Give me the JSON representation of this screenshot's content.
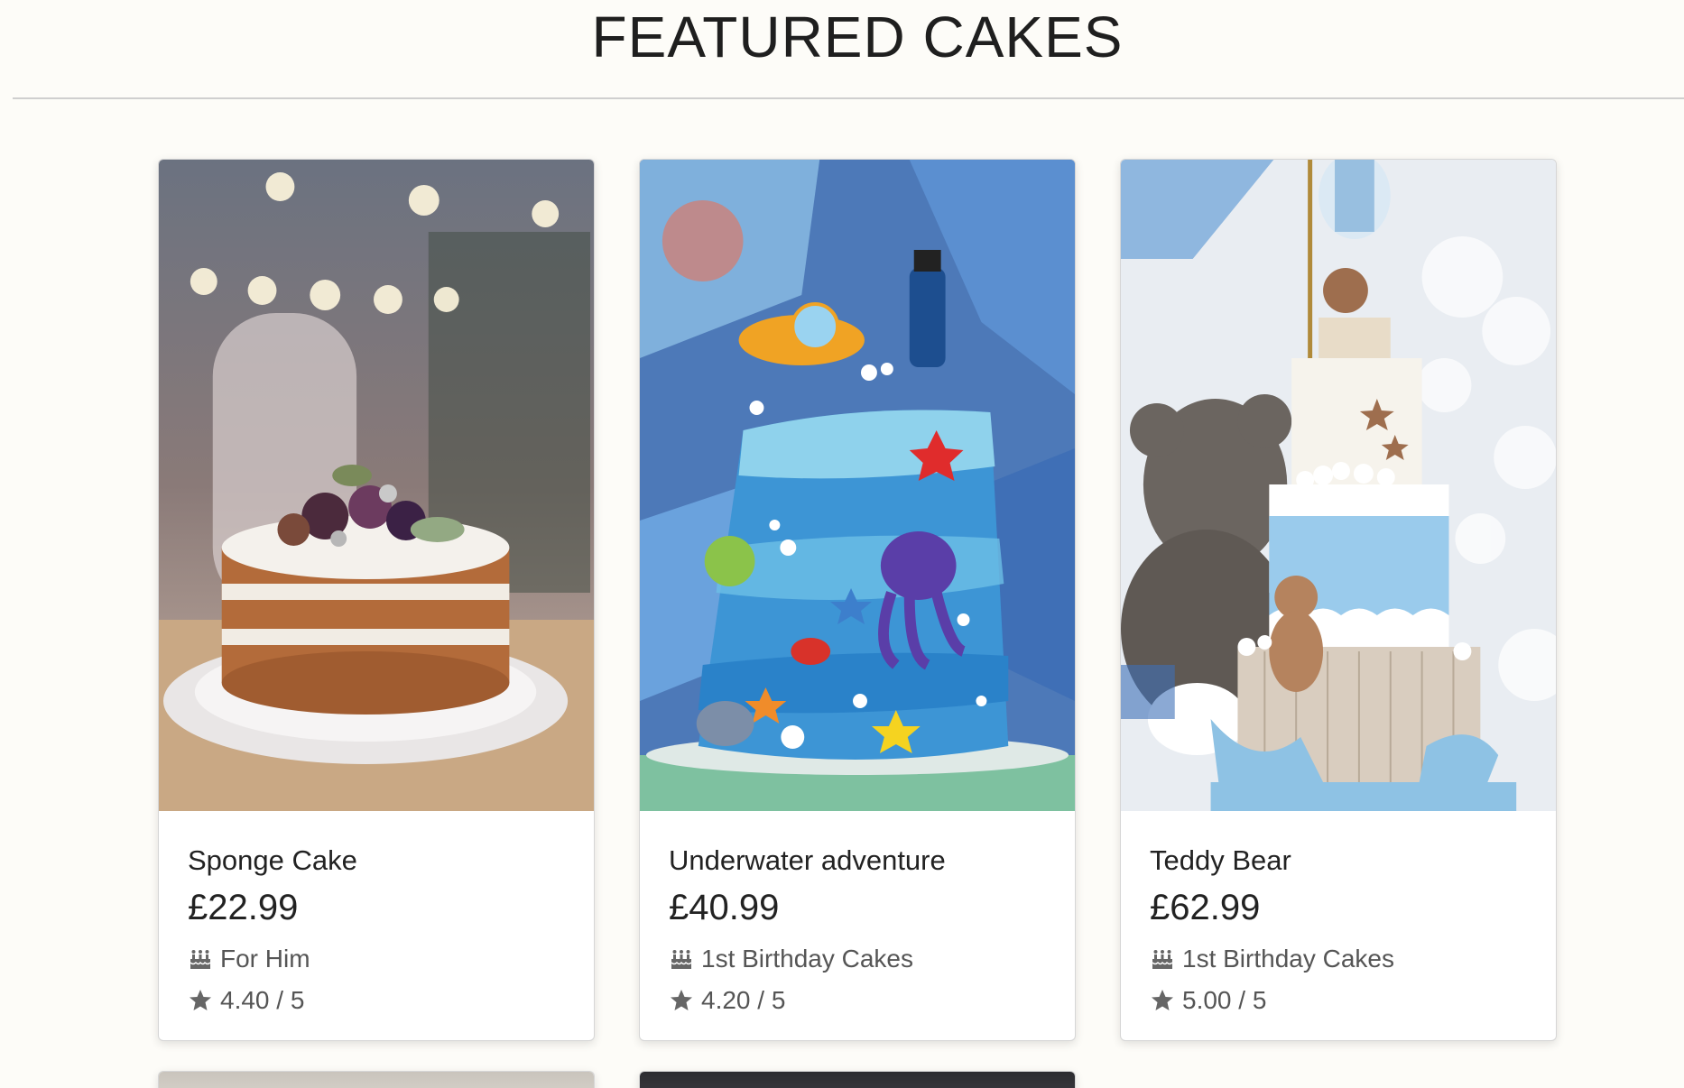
{
  "section": {
    "title": "FEATURED CAKES"
  },
  "icons": {
    "category": "birthday-cake-icon",
    "rating": "star-icon"
  },
  "colors": {
    "background": "#fdfcf8",
    "text": "#222222",
    "muted": "#555555"
  },
  "cakes": [
    {
      "name": "Sponge Cake",
      "price": "£22.99",
      "category": "For Him",
      "rating": "4.40 / 5"
    },
    {
      "name": "Underwater adventure",
      "price": "£40.99",
      "category": "1st Birthday Cakes",
      "rating": "4.20 / 5"
    },
    {
      "name": "Teddy Bear",
      "price": "£62.99",
      "category": "1st Birthday Cakes",
      "rating": "5.00 / 5"
    }
  ]
}
